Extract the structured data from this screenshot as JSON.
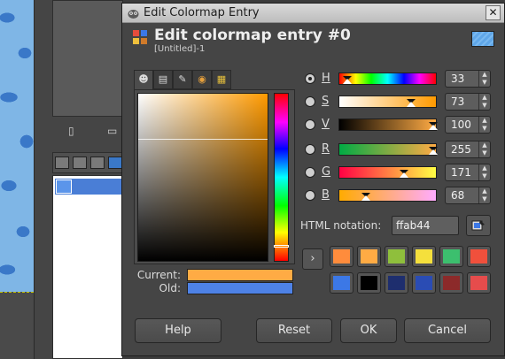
{
  "dialog": {
    "window_title": "Edit Colormap Entry",
    "close_glyph": "✕",
    "header_title": "Edit colormap entry #0",
    "header_subtitle": "[Untitled]-1"
  },
  "selector_tabs": [
    {
      "name": "gimp-selector",
      "glyph": "☻"
    },
    {
      "name": "cmyk-selector",
      "glyph": "▤"
    },
    {
      "name": "watercolor-selector",
      "glyph": "✎"
    },
    {
      "name": "wheel-selector",
      "glyph": "◉"
    },
    {
      "name": "palette-selector",
      "glyph": "▦"
    }
  ],
  "current_label": "Current:",
  "old_label": "Old:",
  "colors": {
    "current": "#ffab44",
    "old": "#4e82e6"
  },
  "channels": [
    {
      "key": "H",
      "value": "33",
      "selected": true
    },
    {
      "key": "S",
      "value": "73",
      "selected": false
    },
    {
      "key": "V",
      "value": "100",
      "selected": false
    },
    {
      "key": "R",
      "value": "255",
      "selected": false
    },
    {
      "key": "G",
      "value": "171",
      "selected": false
    },
    {
      "key": "B",
      "value": "68",
      "selected": false
    }
  ],
  "html_notation": {
    "label": "HTML notation:",
    "value": "ffab44"
  },
  "history_arrow": "›",
  "history_colors": [
    "#ff8c3c",
    "#ffab44",
    "#8fbf3c",
    "#f5e03c",
    "#3cbf6e",
    "#f0503c",
    "#3c78e6",
    "#000000",
    "#1e2e6e",
    "#2a4cb4",
    "#8c2a2a",
    "#e64c4c"
  ],
  "buttons": {
    "help": "Help",
    "reset": "Reset",
    "ok": "OK",
    "cancel": "Cancel"
  }
}
